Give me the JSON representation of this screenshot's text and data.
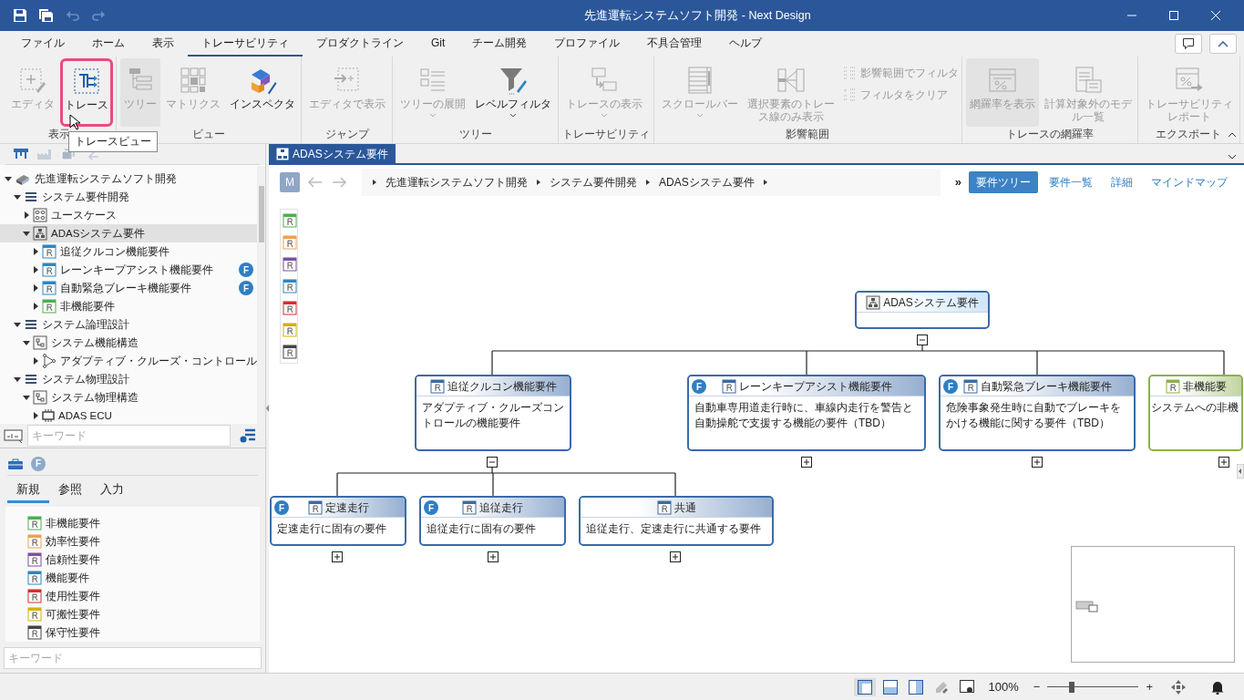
{
  "window": {
    "title": "先進運転システムソフト開発 - Next Design"
  },
  "menu_tabs": [
    {
      "label": "ファイル",
      "selected": false
    },
    {
      "label": "ホーム",
      "selected": false
    },
    {
      "label": "表示",
      "selected": false
    },
    {
      "label": "トレーサビリティ",
      "selected": true
    },
    {
      "label": "プロダクトライン",
      "selected": false
    },
    {
      "label": "Git",
      "selected": false
    },
    {
      "label": "チーム開発",
      "selected": false
    },
    {
      "label": "プロファイル",
      "selected": false
    },
    {
      "label": "不具合管理",
      "selected": false
    },
    {
      "label": "ヘルプ",
      "selected": false
    }
  ],
  "ribbon": {
    "groups": [
      {
        "label": "表示",
        "buttons": [
          {
            "kind": "large",
            "label": "エディタ",
            "disabled": true,
            "pressed": false
          },
          {
            "kind": "large",
            "label": "トレース",
            "disabled": false,
            "pressed": false,
            "highlighted": true
          }
        ]
      },
      {
        "label": "ビュー",
        "buttons": [
          {
            "kind": "large",
            "label": "ツリー",
            "disabled": true,
            "pressed": true
          },
          {
            "kind": "large",
            "label": "マトリクス",
            "disabled": true,
            "pressed": false
          },
          {
            "kind": "large",
            "label": "インスペクタ",
            "disabled": false,
            "pressed": false
          }
        ]
      },
      {
        "label": "ジャンプ",
        "buttons": [
          {
            "kind": "large",
            "label": "エディタで表示",
            "disabled": true,
            "pressed": false
          }
        ]
      },
      {
        "label": "ツリー",
        "buttons": [
          {
            "kind": "large",
            "label": "ツリーの展開",
            "disabled": true,
            "pressed": false,
            "dropdown": true
          },
          {
            "kind": "large",
            "label": "レベルフィルタ",
            "disabled": false,
            "pressed": false,
            "dropdown": true
          }
        ]
      },
      {
        "label": "トレーサビリティ",
        "buttons": [
          {
            "kind": "large",
            "label": "トレースの表示",
            "disabled": true,
            "pressed": false,
            "dropdown": true
          }
        ]
      },
      {
        "label": "影響範囲",
        "buttons": [
          {
            "kind": "large",
            "label": "スクロールバー",
            "disabled": true,
            "pressed": false,
            "dropdown": true
          },
          {
            "kind": "large",
            "label": "選択要素のトレース線のみ表示",
            "disabled": true,
            "pressed": false
          },
          {
            "kind": "small",
            "label": "影響範囲でフィルタ",
            "disabled": true,
            "pressed": false
          },
          {
            "kind": "small",
            "label": "フィルタをクリア",
            "disabled": true,
            "pressed": false
          }
        ]
      },
      {
        "label": "トレースの網羅率",
        "buttons": [
          {
            "kind": "large",
            "label": "網羅率を表示",
            "disabled": true,
            "pressed": true
          },
          {
            "kind": "large",
            "label": "計算対象外のモデル一覧",
            "disabled": true,
            "pressed": false
          }
        ]
      },
      {
        "label": "エクスポート",
        "buttons": [
          {
            "kind": "large",
            "label": "トレーサビリティレポート",
            "disabled": true,
            "pressed": false
          }
        ]
      }
    ]
  },
  "tooltip": "トレースビュー",
  "model_tree": [
    {
      "label": "先進運転システムソフト開発",
      "kind": "project",
      "expanded": true,
      "selected": false,
      "children": [
        {
          "label": "システム要件開発",
          "kind": "package",
          "expanded": true,
          "selected": false,
          "children": [
            {
              "label": "ユースケース",
              "kind": "usecase",
              "expanded": false,
              "selected": false
            },
            {
              "label": "ADASシステム要件",
              "kind": "requirements",
              "expanded": true,
              "selected": true,
              "children": [
                {
                  "label": "追従クルコン機能要件",
                  "kind": "requirement",
                  "color": "#2e86c1",
                  "expanded": false,
                  "selected": false
                },
                {
                  "label": "レーンキープアシスト機能要件",
                  "kind": "requirement",
                  "color": "#2e86c1",
                  "badge": "F",
                  "expanded": false,
                  "selected": false
                },
                {
                  "label": "自動緊急ブレーキ機能要件",
                  "kind": "requirement",
                  "color": "#2e86c1",
                  "badge": "F",
                  "expanded": false,
                  "selected": false
                },
                {
                  "label": "非機能要件",
                  "kind": "requirement",
                  "color": "#4caf50",
                  "expanded": false,
                  "selected": false
                }
              ]
            }
          ]
        },
        {
          "label": "システム論理設計",
          "kind": "package",
          "expanded": true,
          "selected": false,
          "children": [
            {
              "label": "システム機能構造",
              "kind": "structure",
              "expanded": true,
              "selected": false,
              "children": [
                {
                  "label": "アダプティブ・クルーズ・コントロール",
                  "kind": "function",
                  "expanded": false,
                  "selected": false
                }
              ]
            }
          ]
        },
        {
          "label": "システム物理設計",
          "kind": "package",
          "expanded": true,
          "selected": false,
          "children": [
            {
              "label": "システム物理構造",
              "kind": "structure",
              "expanded": true,
              "selected": false,
              "children": [
                {
                  "label": "ADAS ECU",
                  "kind": "hardware",
                  "expanded": false,
                  "selected": false
                }
              ]
            }
          ]
        }
      ]
    }
  ],
  "tree_search": {
    "placeholder": "キーワード"
  },
  "palette_toolbar": {
    "feature_button": "F"
  },
  "palette_tabs": [
    {
      "label": "新規",
      "selected": true
    },
    {
      "label": "参照",
      "selected": false
    },
    {
      "label": "入力",
      "selected": false
    }
  ],
  "palette_items": [
    {
      "label": "非機能要件",
      "color": "#4caf50"
    },
    {
      "label": "効率性要件",
      "color": "#f0a050"
    },
    {
      "label": "信頼性要件",
      "color": "#7b4fa6"
    },
    {
      "label": "機能要件",
      "color": "#2e86c1"
    },
    {
      "label": "使用性要件",
      "color": "#d32f2f"
    },
    {
      "label": "可搬性要件",
      "color": "#d4b106"
    },
    {
      "label": "保守性要件",
      "color": "#444444"
    }
  ],
  "palette_search": {
    "placeholder": "キーワード"
  },
  "editor_tab": "ADASシステム要件",
  "breadcrumb": {
    "avatar": "M",
    "items": [
      "先進運転システムソフト開発",
      "システム要件開発",
      "ADASシステム要件"
    ]
  },
  "overflow": "»",
  "view_tabs": [
    {
      "label": "要件ツリー",
      "selected": true
    },
    {
      "label": "要件一覧",
      "selected": false
    },
    {
      "label": "詳細",
      "selected": false
    },
    {
      "label": "マインドマップ",
      "selected": false
    }
  ],
  "diagram": {
    "root": {
      "title": "ADASシステム要件",
      "kind": "requirements",
      "color": "#3b6aa8",
      "expanded": true,
      "children": [
        {
          "title": "追従クルコン機能要件",
          "kind": "requirement",
          "color": "#3b6aa8",
          "description": "アダプティブ・クルーズコントロールの機能要件",
          "expanded": true,
          "children": [
            {
              "title": "定速走行",
              "kind": "requirement",
              "color": "#3b6aa8",
              "badge": "F",
              "description": "定速走行に固有の要件",
              "expanded": false
            },
            {
              "title": "追従走行",
              "kind": "requirement",
              "color": "#3b6aa8",
              "badge": "F",
              "description": "追従走行に固有の要件",
              "expanded": false
            },
            {
              "title": "共通",
              "kind": "requirement",
              "color": "#3b6aa8",
              "description": "追従走行、定速走行に共通する要件",
              "expanded": false
            }
          ]
        },
        {
          "title": "レーンキープアシスト機能要件",
          "kind": "requirement",
          "color": "#3b6aa8",
          "badge": "F",
          "description": "自動車専用道走行時に、車線内走行を警告と自動操舵で支援する機能の要件（TBD）",
          "expanded": false
        },
        {
          "title": "自動緊急ブレーキ機能要件",
          "kind": "requirement",
          "color": "#3b6aa8",
          "badge": "F",
          "description": "危険事象発生時に自動でブレーキをかける機能に関する要件（TBD）",
          "expanded": false
        },
        {
          "title": "非機能要",
          "kind": "requirement",
          "color": "#8cb14a",
          "description": "システムへの非機",
          "expanded": false
        }
      ]
    }
  },
  "status_bar": {
    "zoom": "100%",
    "zoom_out": "−",
    "zoom_in": "+",
    "zoom_slider": {
      "level": 0.27
    }
  }
}
